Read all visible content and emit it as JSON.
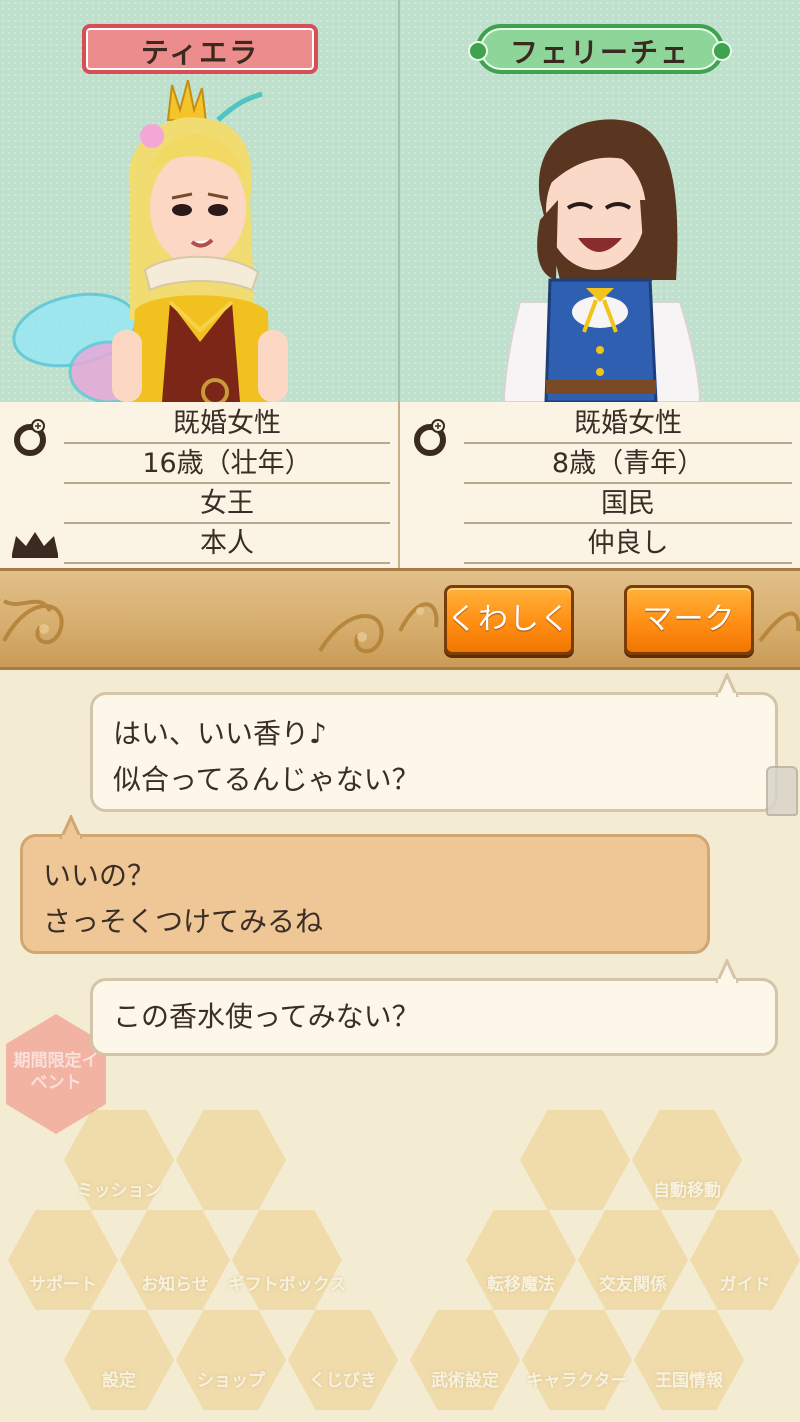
{
  "characters": {
    "left": {
      "name": "ティエラ",
      "info": [
        "既婚女性",
        "16歳（壮年）",
        "女王",
        "本人"
      ],
      "icons": [
        "ring-icon",
        "",
        "",
        "crown-icon"
      ],
      "accent": "#d94d57"
    },
    "right": {
      "name": "フェリーチェ",
      "info": [
        "既婚女性",
        "8歳（青年）",
        "国民",
        "仲良し"
      ],
      "icons": [
        "ring-icon",
        "",
        "",
        ""
      ],
      "accent": "#3ea24f"
    }
  },
  "actions": {
    "detail_label": "くわしく",
    "mark_label": "マーク",
    "button_color": "#ff8e14"
  },
  "chat": [
    {
      "side": "right",
      "lines": [
        "はい、いい香り♪",
        "似合ってるんじゃない？"
      ]
    },
    {
      "side": "left",
      "lines": [
        "いいの？",
        "さっそくつけてみるね"
      ]
    },
    {
      "side": "right",
      "lines": [
        "この香水使ってみない？"
      ]
    }
  ],
  "background_menu": {
    "event_label": "期間限定イベント",
    "items": [
      "ミッション",
      "自動移動",
      "サポート",
      "お知らせ",
      "ギフトボックス",
      "転移魔法",
      "交友関係",
      "ガイド",
      "設定",
      "ショップ",
      "くじびき",
      "武術設定",
      "キャラクター",
      "王国情報"
    ]
  }
}
